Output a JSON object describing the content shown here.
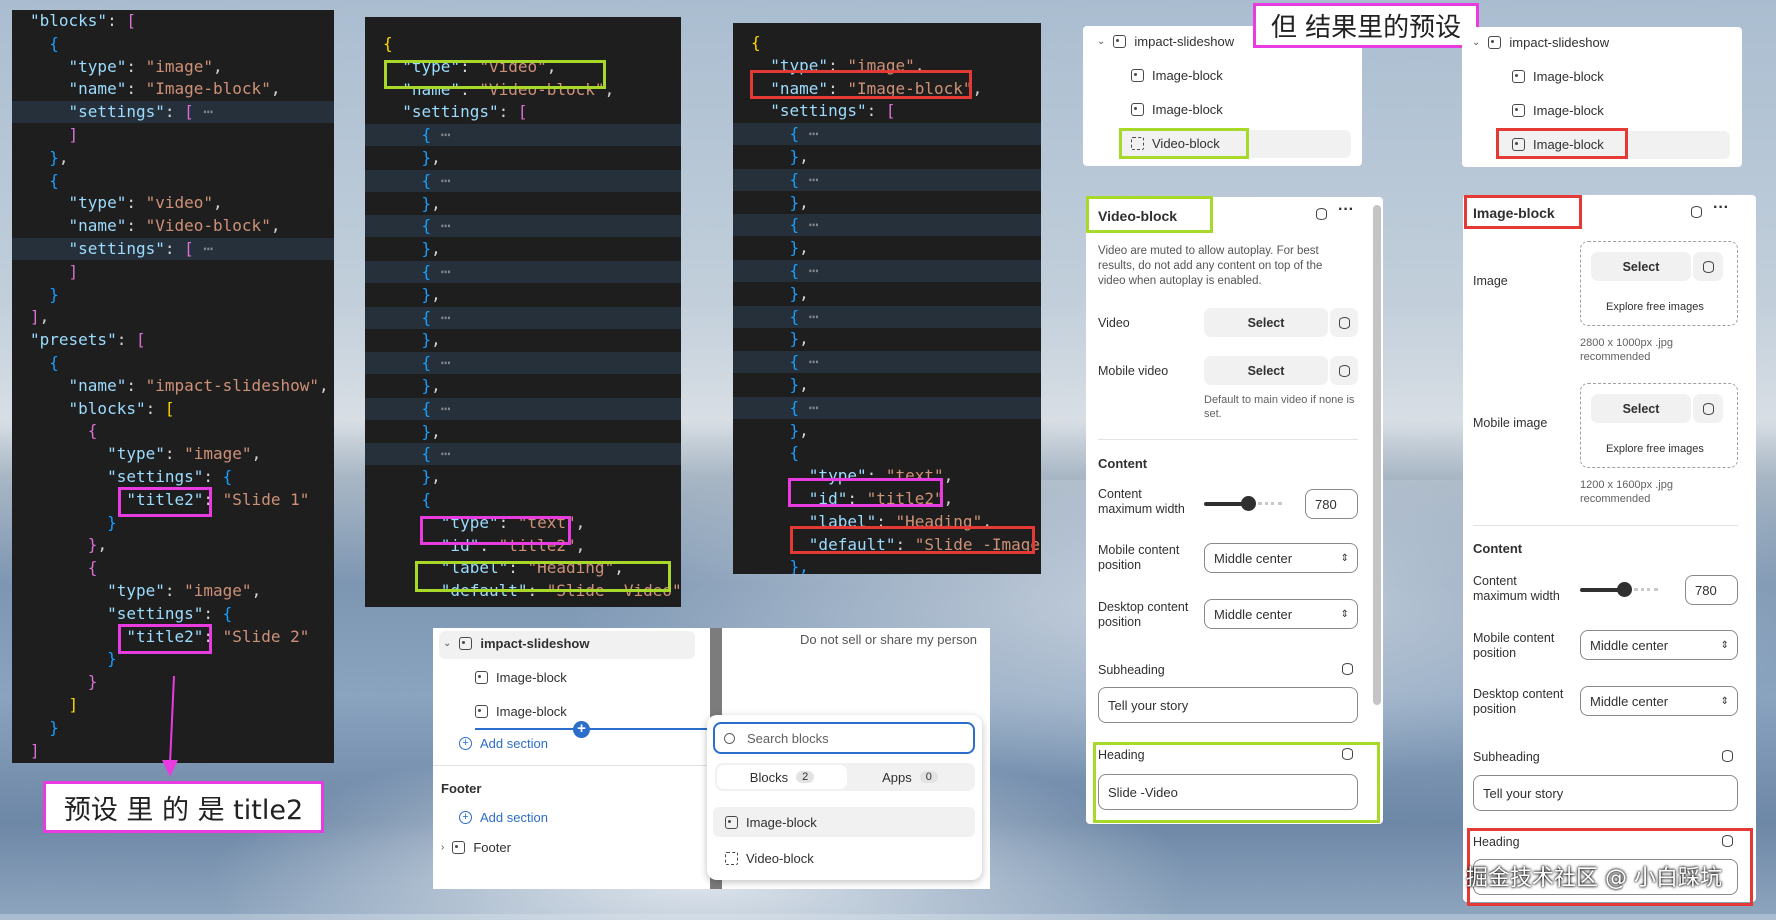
{
  "code1": {
    "lines": [
      [
        [
          "k",
          "\"blocks\""
        ],
        [
          "p",
          ": "
        ],
        [
          "b2",
          "["
        ]
      ],
      [
        [
          "p",
          "  "
        ],
        [
          "b3",
          "{"
        ]
      ],
      [
        [
          "p",
          "    "
        ],
        [
          "k",
          "\"type\""
        ],
        [
          "p",
          ": "
        ],
        [
          "s",
          "\"image\""
        ],
        [
          "p",
          ","
        ]
      ],
      [
        [
          "p",
          "    "
        ],
        [
          "k",
          "\"name\""
        ],
        [
          "p",
          ": "
        ],
        [
          "s",
          "\"Image-block\""
        ],
        [
          "p",
          ","
        ]
      ],
      [
        [
          "p",
          "    "
        ],
        [
          "k",
          "\"settings\""
        ],
        [
          "p",
          ": "
        ],
        [
          "b2",
          "["
        ],
        [
          "e",
          " ⋯"
        ]
      ],
      [
        [
          "p",
          "    "
        ],
        [
          "b2",
          "]"
        ]
      ],
      [
        [
          "p",
          "  "
        ],
        [
          "b3",
          "}"
        ],
        [
          "p",
          ","
        ]
      ],
      [
        [
          "p",
          "  "
        ],
        [
          "b3",
          "{"
        ]
      ],
      [
        [
          "p",
          "    "
        ],
        [
          "k",
          "\"type\""
        ],
        [
          "p",
          ": "
        ],
        [
          "s",
          "\"video\""
        ],
        [
          "p",
          ","
        ]
      ],
      [
        [
          "p",
          "    "
        ],
        [
          "k",
          "\"name\""
        ],
        [
          "p",
          ": "
        ],
        [
          "s",
          "\"Video-block\""
        ],
        [
          "p",
          ","
        ]
      ],
      [
        [
          "p",
          "    "
        ],
        [
          "k",
          "\"settings\""
        ],
        [
          "p",
          ": "
        ],
        [
          "b2",
          "["
        ],
        [
          "e",
          " ⋯"
        ]
      ],
      [
        [
          "p",
          "    "
        ],
        [
          "b2",
          "]"
        ]
      ],
      [
        [
          "p",
          "  "
        ],
        [
          "b3",
          "}"
        ]
      ],
      [
        [
          "b2",
          "]"
        ],
        [
          "p",
          ","
        ]
      ],
      [
        [
          "k",
          "\"presets\""
        ],
        [
          "p",
          ": "
        ],
        [
          "b2",
          "["
        ]
      ],
      [
        [
          "p",
          "  "
        ],
        [
          "b3",
          "{"
        ]
      ],
      [
        [
          "p",
          "    "
        ],
        [
          "k",
          "\"name\""
        ],
        [
          "p",
          ": "
        ],
        [
          "s",
          "\"impact-slideshow\""
        ],
        [
          "p",
          ","
        ]
      ],
      [
        [
          "p",
          "    "
        ],
        [
          "k",
          "\"blocks\""
        ],
        [
          "p",
          ": "
        ],
        [
          "b1",
          "["
        ]
      ],
      [
        [
          "p",
          "      "
        ],
        [
          "b2",
          "{"
        ]
      ],
      [
        [
          "p",
          "        "
        ],
        [
          "k",
          "\"type\""
        ],
        [
          "p",
          ": "
        ],
        [
          "s",
          "\"image\""
        ],
        [
          "p",
          ","
        ]
      ],
      [
        [
          "p",
          "        "
        ],
        [
          "k",
          "\"settings\""
        ],
        [
          "p",
          ": "
        ],
        [
          "b3",
          "{"
        ]
      ],
      [
        [
          "p",
          "          "
        ],
        [
          "k",
          "\"title2\""
        ],
        [
          "p",
          ": "
        ],
        [
          "s",
          "\"Slide 1\""
        ]
      ],
      [
        [
          "p",
          "        "
        ],
        [
          "b3",
          "}"
        ]
      ],
      [
        [
          "p",
          "      "
        ],
        [
          "b2",
          "}"
        ],
        [
          "p",
          ","
        ]
      ],
      [
        [
          "p",
          "      "
        ],
        [
          "b2",
          "{"
        ]
      ],
      [
        [
          "p",
          "        "
        ],
        [
          "k",
          "\"type\""
        ],
        [
          "p",
          ": "
        ],
        [
          "s",
          "\"image\""
        ],
        [
          "p",
          ","
        ]
      ],
      [
        [
          "p",
          "        "
        ],
        [
          "k",
          "\"settings\""
        ],
        [
          "p",
          ": "
        ],
        [
          "b3",
          "{"
        ]
      ],
      [
        [
          "p",
          "          "
        ],
        [
          "k",
          "\"title2\""
        ],
        [
          "p",
          ": "
        ],
        [
          "s",
          "\"Slide 2\""
        ]
      ],
      [
        [
          "p",
          "        "
        ],
        [
          "b3",
          "}"
        ]
      ],
      [
        [
          "p",
          "      "
        ],
        [
          "b2",
          "}"
        ]
      ],
      [
        [
          "p",
          "    "
        ],
        [
          "b1",
          "]"
        ]
      ],
      [
        [
          "p",
          "  "
        ],
        [
          "b3",
          "}"
        ]
      ],
      [
        [
          "b2",
          "]"
        ]
      ]
    ]
  },
  "code2": {
    "lines": [
      [
        [
          "b1",
          "{"
        ]
      ],
      [
        [
          "p",
          "  "
        ],
        [
          "k",
          "\"type\""
        ],
        [
          "p",
          ": "
        ],
        [
          "s",
          "\"video\""
        ],
        [
          "p",
          ","
        ]
      ],
      [
        [
          "p",
          "  "
        ],
        [
          "k",
          "\"name\""
        ],
        [
          "p",
          ": "
        ],
        [
          "s",
          "\"Video-block\""
        ],
        [
          "p",
          ","
        ]
      ],
      [
        [
          "p",
          "  "
        ],
        [
          "k",
          "\"settings\""
        ],
        [
          "p",
          ": "
        ],
        [
          "b2",
          "["
        ]
      ],
      [
        [
          "p",
          "    "
        ],
        [
          "b3",
          "{"
        ],
        [
          "e",
          " ⋯"
        ]
      ],
      [
        [
          "p",
          "    "
        ],
        [
          "b3",
          "}"
        ],
        [
          "p",
          ","
        ]
      ],
      [
        [
          "p",
          "    "
        ],
        [
          "b3",
          "{"
        ],
        [
          "e",
          " ⋯"
        ]
      ],
      [
        [
          "p",
          "    "
        ],
        [
          "b3",
          "}"
        ],
        [
          "p",
          ","
        ]
      ],
      [
        [
          "p",
          "    "
        ],
        [
          "b3",
          "{"
        ],
        [
          "e",
          " ⋯"
        ]
      ],
      [
        [
          "p",
          "    "
        ],
        [
          "b3",
          "}"
        ],
        [
          "p",
          ","
        ]
      ],
      [
        [
          "p",
          "    "
        ],
        [
          "b3",
          "{"
        ],
        [
          "e",
          " ⋯"
        ]
      ],
      [
        [
          "p",
          "    "
        ],
        [
          "b3",
          "}"
        ],
        [
          "p",
          ","
        ]
      ],
      [
        [
          "p",
          "    "
        ],
        [
          "b3",
          "{"
        ],
        [
          "e",
          " ⋯"
        ]
      ],
      [
        [
          "p",
          "    "
        ],
        [
          "b3",
          "}"
        ],
        [
          "p",
          ","
        ]
      ],
      [
        [
          "p",
          "    "
        ],
        [
          "b3",
          "{"
        ],
        [
          "e",
          " ⋯"
        ]
      ],
      [
        [
          "p",
          "    "
        ],
        [
          "b3",
          "}"
        ],
        [
          "p",
          ","
        ]
      ],
      [
        [
          "p",
          "    "
        ],
        [
          "b3",
          "{"
        ],
        [
          "e",
          " ⋯"
        ]
      ],
      [
        [
          "p",
          "    "
        ],
        [
          "b3",
          "}"
        ],
        [
          "p",
          ","
        ]
      ],
      [
        [
          "p",
          "    "
        ],
        [
          "b3",
          "{"
        ],
        [
          "e",
          " ⋯"
        ]
      ],
      [
        [
          "p",
          "    "
        ],
        [
          "b3",
          "}"
        ],
        [
          "p",
          ","
        ]
      ],
      [
        [
          "p",
          "    "
        ],
        [
          "b3",
          "{"
        ]
      ],
      [
        [
          "p",
          "      "
        ],
        [
          "k",
          "\"type\""
        ],
        [
          "p",
          ": "
        ],
        [
          "s",
          "\"text\""
        ],
        [
          "p",
          ","
        ]
      ],
      [
        [
          "p",
          "      "
        ],
        [
          "k",
          "\"id\""
        ],
        [
          "p",
          ": "
        ],
        [
          "s",
          "\"title2\""
        ],
        [
          "p",
          ","
        ]
      ],
      [
        [
          "p",
          "      "
        ],
        [
          "k",
          "\"label\""
        ],
        [
          "p",
          ": "
        ],
        [
          "s",
          "\"Heading\""
        ],
        [
          "p",
          ","
        ]
      ],
      [
        [
          "p",
          "      "
        ],
        [
          "k",
          "\"default\""
        ],
        [
          "p",
          ": "
        ],
        [
          "s",
          "\"Slide -Video\""
        ]
      ],
      [
        [
          "p",
          "    "
        ],
        [
          "b3",
          "},"
        ]
      ]
    ]
  },
  "code3": {
    "lines": [
      [
        [
          "b1",
          "{"
        ]
      ],
      [
        [
          "p",
          "  "
        ],
        [
          "k",
          "\"type\""
        ],
        [
          "p",
          ": "
        ],
        [
          "s",
          "\"image\""
        ],
        [
          "p",
          ","
        ]
      ],
      [
        [
          "p",
          "  "
        ],
        [
          "k",
          "\"name\""
        ],
        [
          "p",
          ": "
        ],
        [
          "s",
          "\"Image-block\""
        ],
        [
          "p",
          ","
        ]
      ],
      [
        [
          "p",
          "  "
        ],
        [
          "k",
          "\"settings\""
        ],
        [
          "p",
          ": "
        ],
        [
          "b2",
          "["
        ]
      ],
      [
        [
          "p",
          "    "
        ],
        [
          "b3",
          "{"
        ],
        [
          "e",
          " ⋯"
        ]
      ],
      [
        [
          "p",
          "    "
        ],
        [
          "b3",
          "}"
        ],
        [
          "p",
          ","
        ]
      ],
      [
        [
          "p",
          "    "
        ],
        [
          "b3",
          "{"
        ],
        [
          "e",
          " ⋯"
        ]
      ],
      [
        [
          "p",
          "    "
        ],
        [
          "b3",
          "}"
        ],
        [
          "p",
          ","
        ]
      ],
      [
        [
          "p",
          "    "
        ],
        [
          "b3",
          "{"
        ],
        [
          "e",
          " ⋯"
        ]
      ],
      [
        [
          "p",
          "    "
        ],
        [
          "b3",
          "}"
        ],
        [
          "p",
          ","
        ]
      ],
      [
        [
          "p",
          "    "
        ],
        [
          "b3",
          "{"
        ],
        [
          "e",
          " ⋯"
        ]
      ],
      [
        [
          "p",
          "    "
        ],
        [
          "b3",
          "}"
        ],
        [
          "p",
          ","
        ]
      ],
      [
        [
          "p",
          "    "
        ],
        [
          "b3",
          "{"
        ],
        [
          "e",
          " ⋯"
        ]
      ],
      [
        [
          "p",
          "    "
        ],
        [
          "b3",
          "}"
        ],
        [
          "p",
          ","
        ]
      ],
      [
        [
          "p",
          "    "
        ],
        [
          "b3",
          "{"
        ],
        [
          "e",
          " ⋯"
        ]
      ],
      [
        [
          "p",
          "    "
        ],
        [
          "b3",
          "}"
        ],
        [
          "p",
          ","
        ]
      ],
      [
        [
          "p",
          "    "
        ],
        [
          "b3",
          "{"
        ],
        [
          "e",
          " ⋯"
        ]
      ],
      [
        [
          "p",
          "    "
        ],
        [
          "b3",
          "}"
        ],
        [
          "p",
          ","
        ]
      ],
      [
        [
          "p",
          "    "
        ],
        [
          "b3",
          "{"
        ]
      ],
      [
        [
          "p",
          "      "
        ],
        [
          "k",
          "\"type\""
        ],
        [
          "p",
          ": "
        ],
        [
          "s",
          "\"text\""
        ],
        [
          "p",
          ","
        ]
      ],
      [
        [
          "p",
          "      "
        ],
        [
          "k",
          "\"id\""
        ],
        [
          "p",
          ": "
        ],
        [
          "s",
          "\"title2\""
        ],
        [
          "p",
          ","
        ]
      ],
      [
        [
          "p",
          "      "
        ],
        [
          "k",
          "\"label\""
        ],
        [
          "p",
          ": "
        ],
        [
          "s",
          "\"Heading\""
        ],
        [
          "p",
          ","
        ]
      ],
      [
        [
          "p",
          "      "
        ],
        [
          "k",
          "\"default\""
        ],
        [
          "p",
          ": "
        ],
        [
          "s",
          "\"Slide -Image\""
        ]
      ],
      [
        [
          "p",
          "    "
        ],
        [
          "b3",
          "},"
        ]
      ]
    ]
  },
  "annot": {
    "preset_title2": "预设 里 的 是 title2",
    "result_preset": "但 结果里的预设"
  },
  "tree_mid": {
    "root": "impact-slideshow",
    "items": [
      "Image-block",
      "Image-block"
    ],
    "add_section": "Add section",
    "footer_group": "Footer",
    "add_section2": "Add section",
    "footer_item": "Footer",
    "privacy": "Do not sell or share my person"
  },
  "picker": {
    "search_placeholder": "Search blocks",
    "tab_blocks": "Blocks",
    "tab_blocks_count": "2",
    "tab_apps": "Apps",
    "tab_apps_count": "0",
    "options": [
      "Image-block",
      "Video-block"
    ]
  },
  "tree_video": {
    "root": "impact-slideshow",
    "items": [
      "Image-block",
      "Image-block",
      "Video-block"
    ]
  },
  "tree_image": {
    "root": "impact-slideshow",
    "items": [
      "Image-block",
      "Image-block",
      "Image-block"
    ]
  },
  "video_panel": {
    "title": "Video-block",
    "notice": "Video are muted to allow autoplay. For best results, do not add any content on top of the video when autoplay is enabled.",
    "video_label": "Video",
    "select": "Select",
    "mobile_video_label": "Mobile video",
    "mobile_note": "Default to main video if none is set.",
    "content": "Content",
    "max_width_label": "Content maximum width",
    "max_width": "780",
    "mobile_pos_label": "Mobile content position",
    "mobile_pos": "Middle center",
    "desktop_pos_label": "Desktop content position",
    "desktop_pos": "Middle center",
    "subheading_label": "Subheading",
    "subheading": "Tell your story",
    "heading_label": "Heading",
    "heading": "Slide -Video"
  },
  "image_panel": {
    "title": "Image-block",
    "image_label": "Image",
    "select": "Select",
    "explore": "Explore free images",
    "image_note": "2800 x 1000px .jpg recommended",
    "mobile_image_label": "Mobile image",
    "mobile_note": "1200 x 1600px .jpg recommended",
    "content": "Content",
    "max_width_label": "Content maximum width",
    "max_width": "780",
    "mobile_pos_label": "Mobile content position",
    "mobile_pos": "Middle center",
    "desktop_pos_label": "Desktop content position",
    "desktop_pos": "Middle center",
    "subheading_label": "Subheading",
    "subheading": "Tell your story",
    "heading_label": "Heading"
  },
  "watermark": "掘金技术社区 @ 小白踩坑"
}
